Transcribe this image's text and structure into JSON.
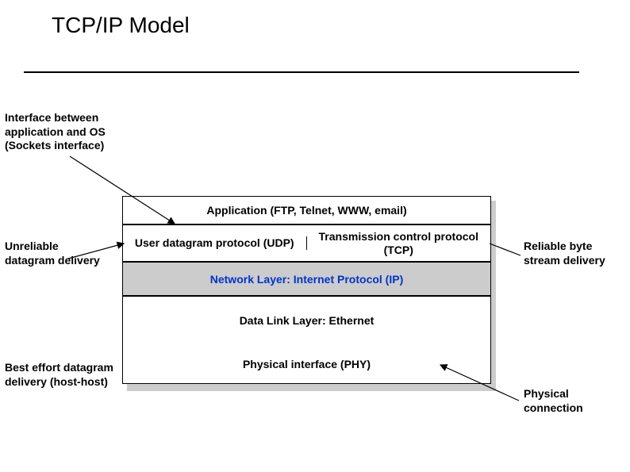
{
  "title": "TCP/IP Model",
  "labels": {
    "sockets": "Interface between application and OS (Sockets interface)",
    "udp": "Unreliable datagram delivery",
    "tcp": "Reliable byte stream delivery",
    "best_effort": "Best effort datagram delivery (host-host)",
    "physical": "Physical connection"
  },
  "layers": {
    "application": "Application (FTP, Telnet, WWW, email)",
    "udp": "User datagram protocol (UDP)",
    "tcp": "Transmission control protocol (TCP)",
    "network": "Network Layer: Internet Protocol (IP)",
    "datalink": "Data Link Layer: Ethernet",
    "physical": "Physical interface (PHY)"
  }
}
